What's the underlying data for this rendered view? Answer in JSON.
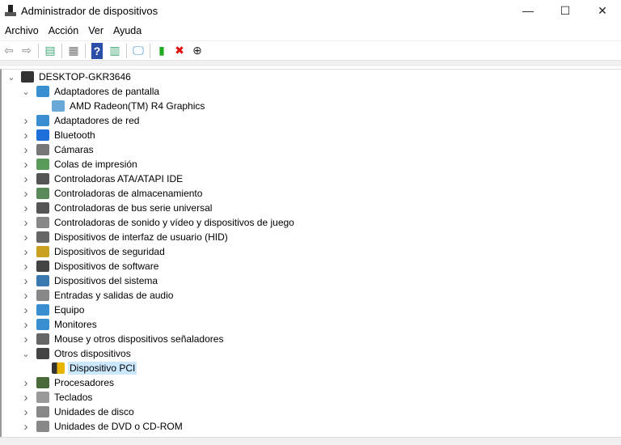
{
  "window": {
    "title": "Administrador de dispositivos",
    "minimize": "—",
    "maximize": "☐",
    "close": "✕"
  },
  "menu": [
    "Archivo",
    "Acción",
    "Ver",
    "Ayuda"
  ],
  "toolbar": [
    {
      "name": "back-icon",
      "glyph": "⇦",
      "color": "#888"
    },
    {
      "name": "forward-icon",
      "glyph": "⇨",
      "color": "#888"
    },
    {
      "sep": true
    },
    {
      "name": "show-hide-console-tree-icon",
      "glyph": "▤",
      "color": "#4a7"
    },
    {
      "sep": true
    },
    {
      "name": "properties-icon",
      "glyph": "▦",
      "color": "#777"
    },
    {
      "sep": true
    },
    {
      "name": "help-icon",
      "glyph": "?",
      "color": "#fff",
      "bg": "#2b4fa8"
    },
    {
      "name": "action-pane-icon",
      "glyph": "▥",
      "color": "#4a7"
    },
    {
      "sep": true
    },
    {
      "name": "scan-hardware-icon",
      "glyph": "🖵",
      "color": "#3a8fd0"
    },
    {
      "sep": true
    },
    {
      "name": "update-driver-icon",
      "glyph": "▮",
      "color": "#2a2"
    },
    {
      "name": "uninstall-icon",
      "glyph": "✖",
      "color": "#e01010"
    },
    {
      "name": "disable-device-icon",
      "glyph": "⊕",
      "color": "#222"
    }
  ],
  "tree": [
    {
      "label": "DESKTOP-GKR3646",
      "level": 0,
      "chev": "open",
      "icon": "computer",
      "color": "#333"
    },
    {
      "label": "Adaptadores de pantalla",
      "level": 1,
      "chev": "open",
      "icon": "display",
      "color": "#3a8fd0"
    },
    {
      "label": "AMD Radeon(TM) R4 Graphics",
      "level": 2,
      "chev": "none",
      "icon": "display-device",
      "color": "#6aa8d8"
    },
    {
      "label": "Adaptadores de red",
      "level": 1,
      "chev": "closed",
      "icon": "network",
      "color": "#3a8fd0"
    },
    {
      "label": "Bluetooth",
      "level": 1,
      "chev": "closed",
      "icon": "bluetooth",
      "color": "#1e6fd9"
    },
    {
      "label": "Cámaras",
      "level": 1,
      "chev": "closed",
      "icon": "camera",
      "color": "#777"
    },
    {
      "label": "Colas de impresión",
      "level": 1,
      "chev": "closed",
      "icon": "printer",
      "color": "#5a9a5a"
    },
    {
      "label": "Controladoras ATA/ATAPI IDE",
      "level": 1,
      "chev": "closed",
      "icon": "ide",
      "color": "#555"
    },
    {
      "label": "Controladoras de almacenamiento",
      "level": 1,
      "chev": "closed",
      "icon": "storage",
      "color": "#5a8a5a"
    },
    {
      "label": "Controladoras de bus serie universal",
      "level": 1,
      "chev": "closed",
      "icon": "usb",
      "color": "#555"
    },
    {
      "label": "Controladoras de sonido y vídeo y dispositivos de juego",
      "level": 1,
      "chev": "closed",
      "icon": "sound",
      "color": "#888"
    },
    {
      "label": "Dispositivos de interfaz de usuario (HID)",
      "level": 1,
      "chev": "closed",
      "icon": "hid",
      "color": "#666"
    },
    {
      "label": "Dispositivos de seguridad",
      "level": 1,
      "chev": "closed",
      "icon": "security",
      "color": "#c9a020"
    },
    {
      "label": "Dispositivos de software",
      "level": 1,
      "chev": "closed",
      "icon": "software",
      "color": "#444"
    },
    {
      "label": "Dispositivos del sistema",
      "level": 1,
      "chev": "closed",
      "icon": "system",
      "color": "#3a7ab0"
    },
    {
      "label": "Entradas y salidas de audio",
      "level": 1,
      "chev": "closed",
      "icon": "audio",
      "color": "#888"
    },
    {
      "label": "Equipo",
      "level": 1,
      "chev": "closed",
      "icon": "monitor",
      "color": "#3a8fd0"
    },
    {
      "label": "Monitores",
      "level": 1,
      "chev": "closed",
      "icon": "monitor",
      "color": "#3a8fd0"
    },
    {
      "label": "Mouse y otros dispositivos señaladores",
      "level": 1,
      "chev": "closed",
      "icon": "mouse",
      "color": "#666"
    },
    {
      "label": "Otros dispositivos",
      "level": 1,
      "chev": "open",
      "icon": "unknown",
      "color": "#444"
    },
    {
      "label": "Dispositivo PCI",
      "level": 2,
      "chev": "none",
      "icon": "warning",
      "color": "#e8b400",
      "selected": true
    },
    {
      "label": "Procesadores",
      "level": 1,
      "chev": "closed",
      "icon": "cpu",
      "color": "#4a6a3a"
    },
    {
      "label": "Teclados",
      "level": 1,
      "chev": "closed",
      "icon": "keyboard",
      "color": "#999"
    },
    {
      "label": "Unidades de disco",
      "level": 1,
      "chev": "closed",
      "icon": "disk",
      "color": "#888"
    },
    {
      "label": "Unidades de DVD o CD-ROM",
      "level": 1,
      "chev": "closed",
      "icon": "dvd",
      "color": "#888"
    }
  ]
}
